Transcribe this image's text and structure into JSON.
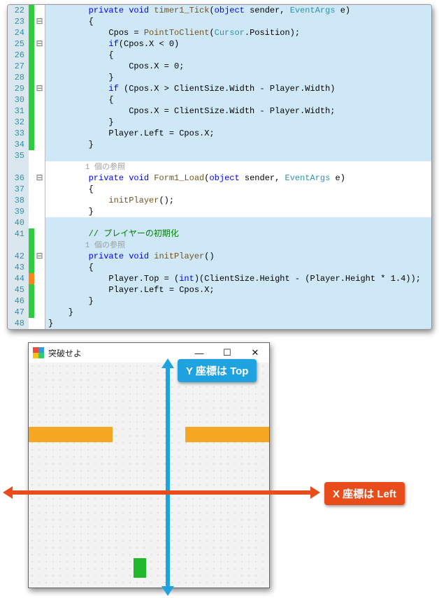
{
  "code": {
    "lines": [
      {
        "n": "22",
        "marker": "green",
        "outline": "",
        "bg": "hl",
        "parts": [
          [
            "txt",
            "        "
          ],
          [
            "kw",
            "private"
          ],
          [
            "txt",
            " "
          ],
          [
            "kw",
            "void"
          ],
          [
            "txt",
            " "
          ],
          [
            "mth",
            "timer1_Tick"
          ],
          [
            "txt",
            "("
          ],
          [
            "kw",
            "object"
          ],
          [
            "txt",
            " sender, "
          ],
          [
            "tp",
            "EventArgs"
          ],
          [
            "txt",
            " e)"
          ]
        ]
      },
      {
        "n": "23",
        "marker": "green",
        "outline": "⊟",
        "bg": "hl",
        "parts": [
          [
            "txt",
            "        {"
          ]
        ]
      },
      {
        "n": "24",
        "marker": "green",
        "outline": "",
        "bg": "hl",
        "parts": [
          [
            "txt",
            "            Cpos = "
          ],
          [
            "mth",
            "PointToClient"
          ],
          [
            "txt",
            "("
          ],
          [
            "tp",
            "Cursor"
          ],
          [
            "txt",
            ".Position);"
          ]
        ]
      },
      {
        "n": "25",
        "marker": "green",
        "outline": "⊟",
        "bg": "hl",
        "parts": [
          [
            "txt",
            "            "
          ],
          [
            "kw",
            "if"
          ],
          [
            "txt",
            "(Cpos.X < 0)"
          ]
        ]
      },
      {
        "n": "26",
        "marker": "green",
        "outline": "",
        "bg": "hl",
        "parts": [
          [
            "txt",
            "            {"
          ]
        ]
      },
      {
        "n": "27",
        "marker": "green",
        "outline": "",
        "bg": "hl",
        "parts": [
          [
            "txt",
            "                Cpos.X = 0;"
          ]
        ]
      },
      {
        "n": "28",
        "marker": "green",
        "outline": "",
        "bg": "hl",
        "parts": [
          [
            "txt",
            "            }"
          ]
        ]
      },
      {
        "n": "29",
        "marker": "green",
        "outline": "⊟",
        "bg": "hl",
        "parts": [
          [
            "txt",
            "            "
          ],
          [
            "kw",
            "if"
          ],
          [
            "txt",
            " (Cpos.X > ClientSize.Width - Player.Width)"
          ]
        ]
      },
      {
        "n": "30",
        "marker": "green",
        "outline": "",
        "bg": "hl",
        "parts": [
          [
            "txt",
            "            {"
          ]
        ]
      },
      {
        "n": "31",
        "marker": "green",
        "outline": "",
        "bg": "hl",
        "parts": [
          [
            "txt",
            "                Cpos.X = ClientSize.Width - Player.Width;"
          ]
        ]
      },
      {
        "n": "32",
        "marker": "green",
        "outline": "",
        "bg": "hl",
        "parts": [
          [
            "txt",
            "            }"
          ]
        ]
      },
      {
        "n": "33",
        "marker": "green",
        "outline": "",
        "bg": "hl",
        "parts": [
          [
            "txt",
            "            Player.Left = Cpos.X;"
          ]
        ]
      },
      {
        "n": "34",
        "marker": "green",
        "outline": "",
        "bg": "hl",
        "parts": [
          [
            "txt",
            "        }"
          ]
        ]
      },
      {
        "n": "35",
        "marker": "",
        "outline": "",
        "bg": "hl",
        "parts": [
          [
            "txt",
            " "
          ]
        ]
      },
      {
        "n": "",
        "marker": "",
        "outline": "",
        "bg": "plain",
        "parts": [
          [
            "ref",
            "        1 個の参照"
          ]
        ]
      },
      {
        "n": "36",
        "marker": "",
        "outline": "⊟",
        "bg": "plain",
        "parts": [
          [
            "txt",
            "        "
          ],
          [
            "kw",
            "private"
          ],
          [
            "txt",
            " "
          ],
          [
            "kw",
            "void"
          ],
          [
            "txt",
            " "
          ],
          [
            "mth",
            "Form1_Load"
          ],
          [
            "txt",
            "("
          ],
          [
            "kw",
            "object"
          ],
          [
            "txt",
            " sender, "
          ],
          [
            "tp",
            "EventArgs"
          ],
          [
            "txt",
            " e)"
          ]
        ]
      },
      {
        "n": "37",
        "marker": "",
        "outline": "",
        "bg": "plain",
        "parts": [
          [
            "txt",
            "        {"
          ]
        ]
      },
      {
        "n": "38",
        "marker": "",
        "outline": "",
        "bg": "plain",
        "parts": [
          [
            "txt",
            "            "
          ],
          [
            "mth",
            "initPlayer"
          ],
          [
            "txt",
            "();"
          ]
        ]
      },
      {
        "n": "39",
        "marker": "",
        "outline": "",
        "bg": "plain",
        "parts": [
          [
            "txt",
            "        }"
          ]
        ]
      },
      {
        "n": "40",
        "marker": "",
        "outline": "",
        "bg": "hl",
        "parts": [
          [
            "txt",
            " "
          ]
        ]
      },
      {
        "n": "41",
        "marker": "green",
        "outline": "",
        "bg": "hl",
        "parts": [
          [
            "txt",
            "        "
          ],
          [
            "cm",
            "// プレイヤーの初期化"
          ]
        ]
      },
      {
        "n": "",
        "marker": "green",
        "outline": "",
        "bg": "hl",
        "parts": [
          [
            "ref",
            "        1 個の参照"
          ]
        ]
      },
      {
        "n": "42",
        "marker": "green",
        "outline": "⊟",
        "bg": "hl",
        "parts": [
          [
            "txt",
            "        "
          ],
          [
            "kw",
            "private"
          ],
          [
            "txt",
            " "
          ],
          [
            "kw",
            "void"
          ],
          [
            "txt",
            " "
          ],
          [
            "mth",
            "initPlayer"
          ],
          [
            "txt",
            "()"
          ]
        ]
      },
      {
        "n": "43",
        "marker": "green",
        "outline": "",
        "bg": "hl",
        "parts": [
          [
            "txt",
            "        {"
          ]
        ]
      },
      {
        "n": "44",
        "marker": "orange",
        "outline": "",
        "bg": "hl",
        "parts": [
          [
            "txt",
            "            Player.Top = ("
          ],
          [
            "kw",
            "int"
          ],
          [
            "txt",
            ")(ClientSize.Height - (Player.Height * 1.4));"
          ]
        ]
      },
      {
        "n": "45",
        "marker": "green",
        "outline": "",
        "bg": "hl",
        "parts": [
          [
            "txt",
            "            Player.Left = Cpos.X;"
          ]
        ]
      },
      {
        "n": "46",
        "marker": "green",
        "outline": "",
        "bg": "hl",
        "parts": [
          [
            "txt",
            "        }"
          ]
        ]
      },
      {
        "n": "47",
        "marker": "green",
        "outline": "",
        "bg": "hl",
        "parts": [
          [
            "txt",
            "    }"
          ]
        ]
      },
      {
        "n": "48",
        "marker": "",
        "outline": "",
        "bg": "hl",
        "parts": [
          [
            "txt",
            "}"
          ]
        ]
      }
    ]
  },
  "form": {
    "title": "突破せよ",
    "winbtns": {
      "min": "—",
      "max": "☐",
      "close": "✕"
    }
  },
  "labels": {
    "y": "Y 座標は Top",
    "x": "X 座標は Left"
  }
}
